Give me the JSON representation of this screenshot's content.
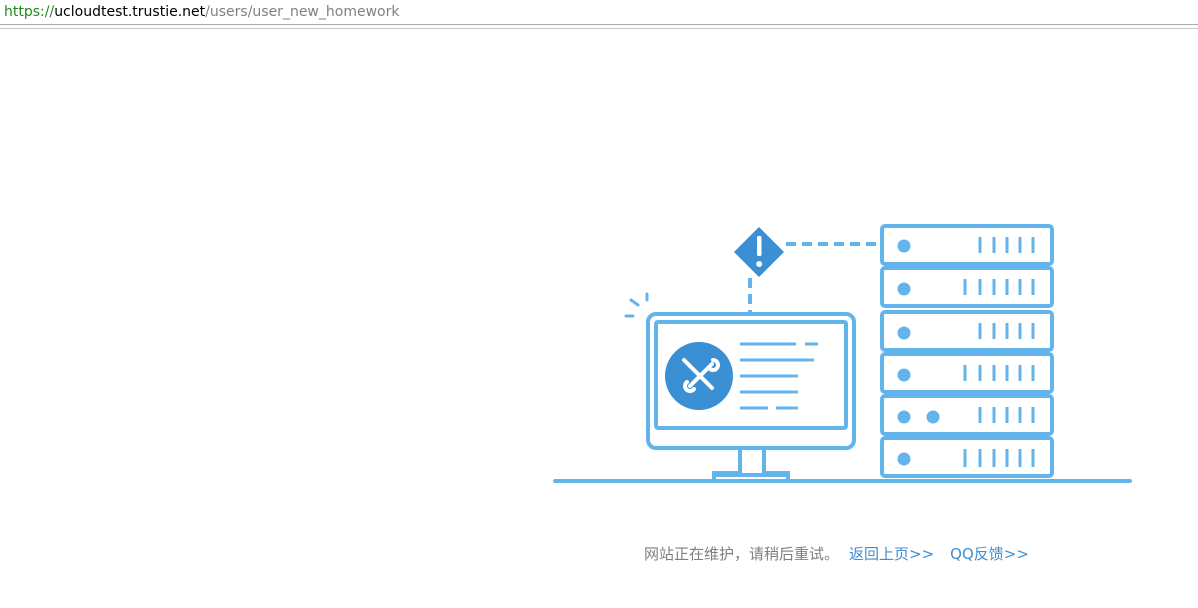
{
  "address_bar": {
    "scheme": "https://",
    "host": "ucloudtest.trustie.net",
    "path": "/users/user_new_homework"
  },
  "illustration": {
    "alert_icon": "exclamation-diamond-icon",
    "tools_icon": "wrench-screwdriver-icon",
    "accent_color": "#64b4ec",
    "dark_accent_color": "#3a8fd5",
    "server_count": 6
  },
  "message": {
    "text": "网站正在维护，请稍后重试。",
    "back_link": "返回上页>>",
    "feedback_link": "QQ反馈>>"
  },
  "colors": {
    "text_gray": "#7f7f7f",
    "link_blue": "#3e8fd6"
  }
}
